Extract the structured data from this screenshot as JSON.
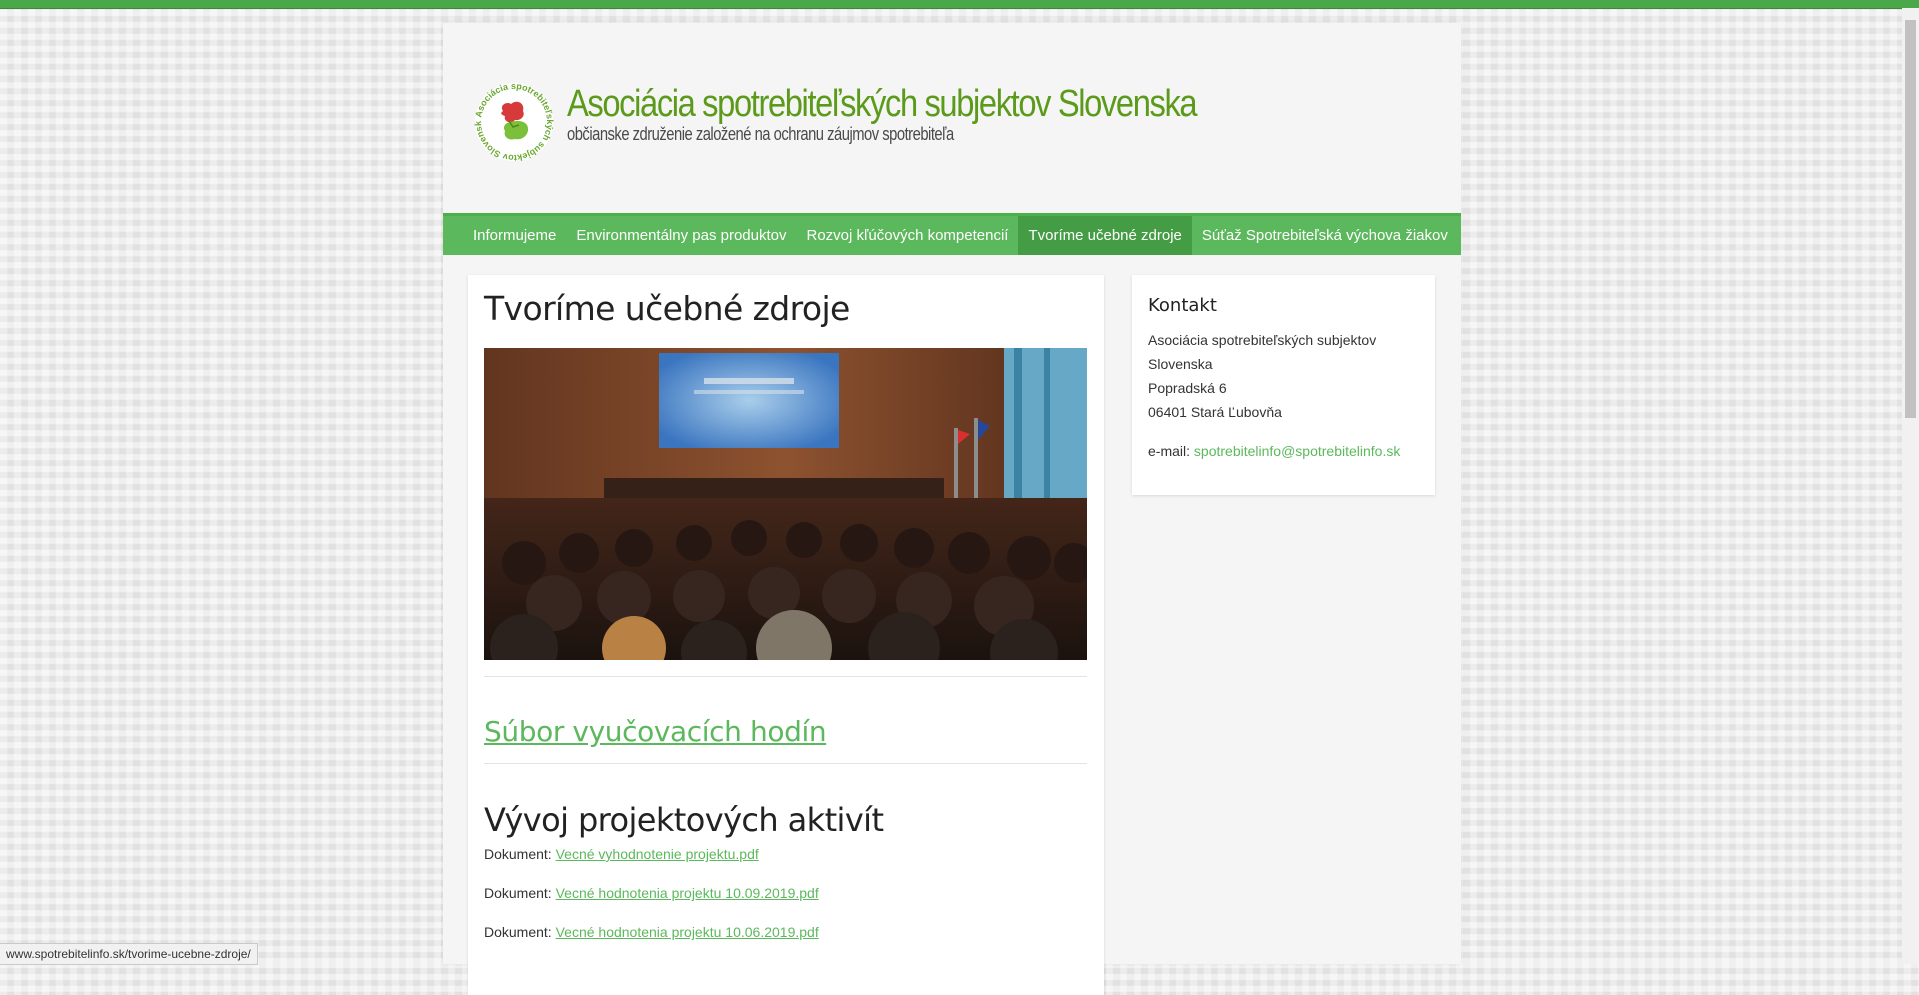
{
  "header": {
    "logo_text": "Asociácia spotrebiteľských subjektov Slovenska",
    "title": "Asociácia spotrebiteľských subjektov Slovenska",
    "tagline": "občianske združenie založené na ochranu záujmov spotrebiteľa"
  },
  "nav": {
    "items": [
      {
        "label": "Informujeme"
      },
      {
        "label": "Environmentálny pas produktov"
      },
      {
        "label": "Rozvoj kľúčových kompetencií"
      },
      {
        "label": "Tvoríme učebné zdroje",
        "active": true
      },
      {
        "label": "Súťaž Spotrebiteľská výchova žiakov"
      }
    ]
  },
  "main": {
    "title": "Tvoríme učebné zdroje",
    "link_heading": "Súbor vyučovacích hodín",
    "section_heading": "Vývoj projektových aktivít",
    "documents": [
      {
        "prefix": "Dokument:",
        "link": "Vecné vyhodnotenie projektu.pdf"
      },
      {
        "prefix": "Dokument:",
        "link": "Vecné hodnotenia projektu 10.09.2019.pdf"
      },
      {
        "prefix": "Dokument:",
        "link": "Vecné hodnotenia projektu 10.06.2019.pdf"
      }
    ]
  },
  "sidebar": {
    "title": "Kontakt",
    "org_line1": "Asociácia spotrebiteľských subjektov",
    "org_line2": "Slovenska",
    "street": "Popradská 6",
    "city": "06401 Stará Ľubovňa",
    "email_label": "e-mail:",
    "email": "spotrebitelinfo@spotrebitelinfo.sk"
  },
  "status_bar": {
    "url": "www.spotrebitelinfo.sk/tvorime-ucebne-zdroje/"
  },
  "colors": {
    "accent_green": "#5cb85c",
    "title_green": "#5b9a1a"
  }
}
